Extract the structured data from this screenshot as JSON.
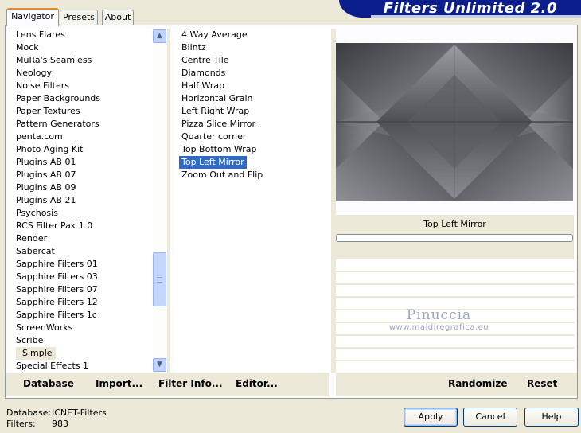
{
  "header": {
    "title": "Filters Unlimited 2.0"
  },
  "tabs": [
    {
      "label": "Navigator",
      "active": true
    },
    {
      "label": "Presets",
      "active": false
    },
    {
      "label": "About",
      "active": false
    }
  ],
  "categories": {
    "items": [
      "Lens Flares",
      "Mock",
      "MuRa's Seamless",
      "Neology",
      "Noise Filters",
      "Paper Backgrounds",
      "Paper Textures",
      "Pattern Generators",
      "penta.com",
      "Photo Aging Kit",
      "Plugins AB 01",
      "Plugins AB 07",
      "Plugins AB 09",
      "Plugins AB 21",
      "Psychosis",
      "RCS Filter Pak 1.0",
      "Render",
      "Sabercat",
      "Sapphire Filters 01",
      "Sapphire Filters 03",
      "Sapphire Filters 07",
      "Sapphire Filters 12",
      "Sapphire Filters 1c",
      "ScreenWorks",
      "Scribe",
      "Simple",
      "Special Effects 1"
    ],
    "selected": "Simple"
  },
  "filters": {
    "items": [
      "4 Way Average",
      "Blintz",
      "Centre Tile",
      "Diamonds",
      "Half Wrap",
      "Horizontal Grain",
      "Left Right Wrap",
      "Pizza Slice Mirror",
      "Quarter corner",
      "Top Bottom Wrap",
      "Top Left Mirror",
      "Zoom Out and Flip"
    ],
    "selected": "Top Left Mirror"
  },
  "preview": {
    "filter_name": "Top Left Mirror",
    "progress": 0
  },
  "watermark": {
    "name": "Pinuccia",
    "url": "www.maidiregrafica.eu"
  },
  "toolbar": {
    "database": "Database",
    "import": "Import...",
    "filter_info": "Filter Info...",
    "editor": "Editor...",
    "randomize": "Randomize",
    "reset": "Reset"
  },
  "footer": {
    "database_label": "Database:",
    "database_value": "ICNET-Filters",
    "filters_label": "Filters:",
    "filters_value": "983"
  },
  "buttons": {
    "apply": "Apply",
    "cancel": "Cancel",
    "help": "Help"
  },
  "colors": {
    "selection": "#316ac5",
    "banner": "#0b1e8c",
    "tab_accent": "#e68b2c"
  }
}
